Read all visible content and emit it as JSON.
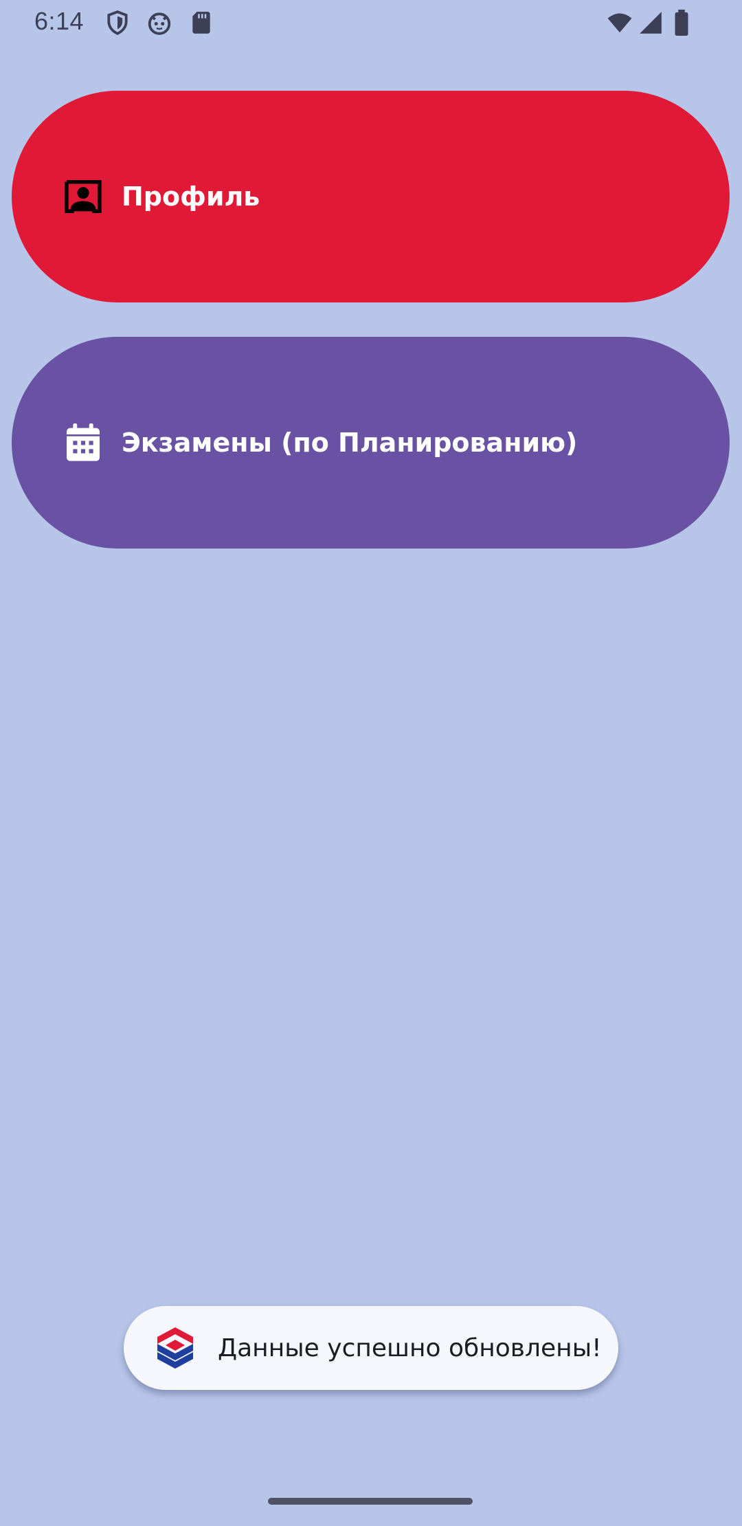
{
  "status_bar": {
    "time": "6:14",
    "left_icons": [
      "shield-icon",
      "cat-face-icon",
      "sd-card-icon"
    ],
    "right_icons": [
      "wifi-icon",
      "signal-icon",
      "battery-icon"
    ]
  },
  "menu": {
    "items": [
      {
        "label": "Профиль",
        "icon": "profile-card-icon",
        "color": "#e01937"
      },
      {
        "label": "Экзамены (по Планированию)",
        "icon": "calendar-icon",
        "color": "#6952a4"
      }
    ]
  },
  "toast": {
    "message": "Данные успешно обновлены!",
    "icon": "app-logo-icon"
  },
  "colors": {
    "background": "#b6c5e8",
    "toast_background": "#f5f7fc",
    "status_icons": "#3c3f55"
  }
}
